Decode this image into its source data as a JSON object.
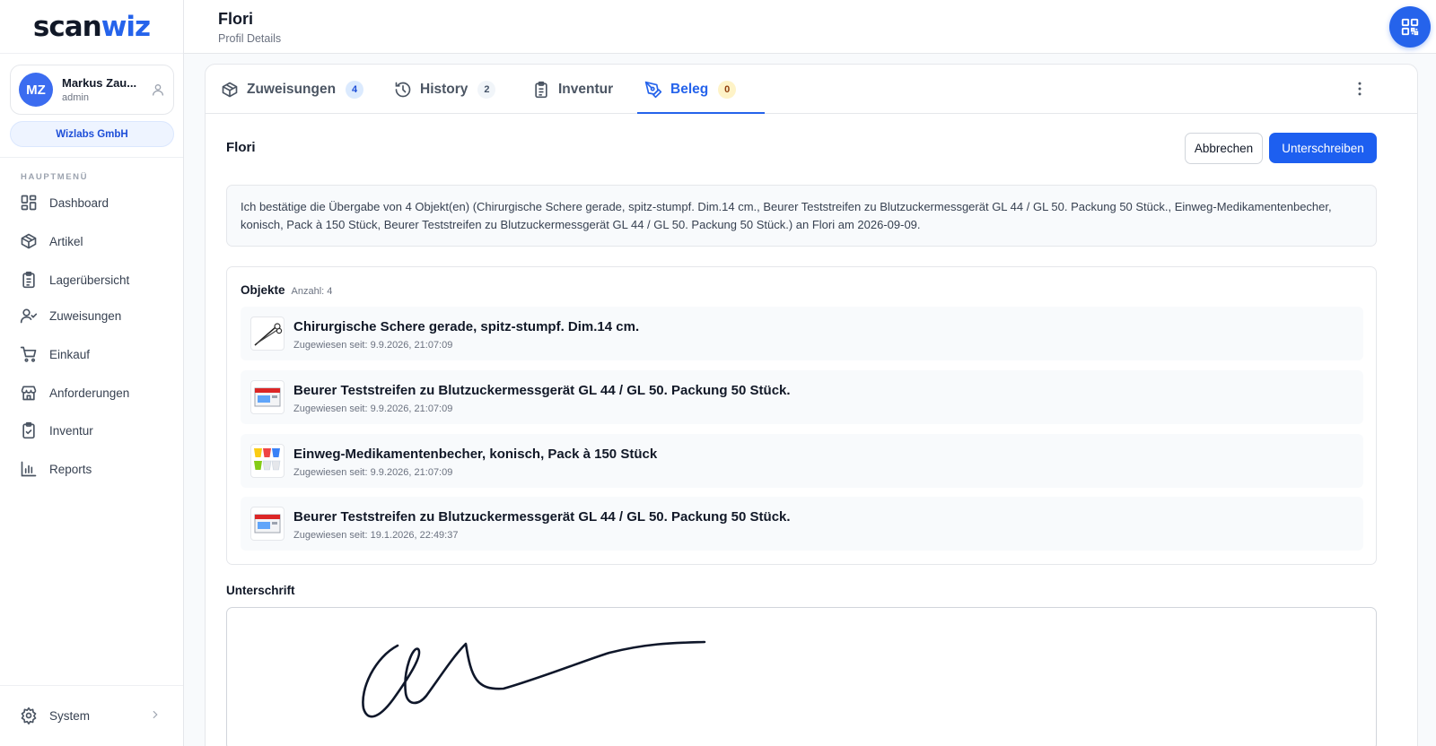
{
  "app": {
    "logo_scan": "scan",
    "logo_wiz": "wiz",
    "brand_color": "#2563eb"
  },
  "user": {
    "initials": "MZ",
    "name": "Markus Zau...",
    "role": "admin",
    "company": "Wizlabs GmbH"
  },
  "sidebar": {
    "heading": "HAUPTMENÜ",
    "items": [
      {
        "label": "Dashboard",
        "icon": "dashboard-icon"
      },
      {
        "label": "Artikel",
        "icon": "box-icon"
      },
      {
        "label": "Lagerübersicht",
        "icon": "clipboard-icon"
      },
      {
        "label": "Zuweisungen",
        "icon": "user-check-icon"
      },
      {
        "label": "Einkauf",
        "icon": "cart-icon"
      },
      {
        "label": "Anforderungen",
        "icon": "store-icon"
      },
      {
        "label": "Inventur",
        "icon": "clipboard-check-icon"
      },
      {
        "label": "Reports",
        "icon": "bar-chart-icon"
      }
    ],
    "system_label": "System"
  },
  "header": {
    "title": "Flori",
    "subtitle": "Profil Details"
  },
  "tabs": [
    {
      "label": "Zuweisungen",
      "badge": "4",
      "icon": "box-icon"
    },
    {
      "label": "History",
      "badge": "2",
      "icon": "history-icon"
    },
    {
      "label": "Inventur",
      "badge": "",
      "icon": "clipboard-icon"
    },
    {
      "label": "Beleg",
      "badge": "0",
      "icon": "pen-tool-icon",
      "active": true
    }
  ],
  "beleg": {
    "person": "Flori",
    "cancel_label": "Abbrechen",
    "sign_label": "Unterschreiben",
    "confirmation_text": "Ich bestätige die Übergabe von 4 Objekt(en) (Chirurgische Schere gerade, spitz-stumpf. Dim.14 cm., Beurer Teststreifen zu Blutzuckermessgerät GL 44 / GL 50. Packung 50 Stück., Einweg-Medikamentenbecher, konisch, Pack à 150 Stück, Beurer Teststreifen zu Blutzuckermessgerät GL 44 / GL 50. Packung 50 Stück.) an Flori am 2026-09-09.",
    "objects_title": "Objekte",
    "objects_count": "Anzahl: 4",
    "objects": [
      {
        "name": "Chirurgische Schere gerade, spitz-stumpf. Dim.14 cm.",
        "assigned": "Zugewiesen seit: 9.9.2026, 21:07:09",
        "thumb": "scissors"
      },
      {
        "name": "Beurer Teststreifen zu Blutzuckermessgerät GL 44 / GL 50. Packung 50 Stück.",
        "assigned": "Zugewiesen seit: 9.9.2026, 21:07:09",
        "thumb": "box"
      },
      {
        "name": "Einweg-Medikamentenbecher, konisch, Pack à 150 Stück",
        "assigned": "Zugewiesen seit: 9.9.2026, 21:07:09",
        "thumb": "cups"
      },
      {
        "name": "Beurer Teststreifen zu Blutzuckermessgerät GL 44 / GL 50. Packung 50 Stück.",
        "assigned": "Zugewiesen seit: 19.1.2026, 22:49:37",
        "thumb": "box"
      }
    ],
    "signature_label": "Unterschrift"
  }
}
